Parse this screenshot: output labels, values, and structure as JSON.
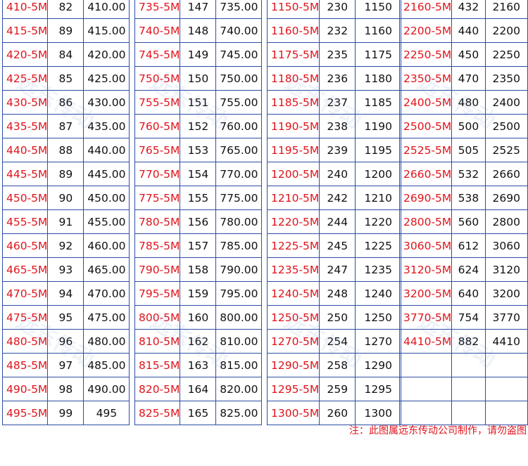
{
  "tables": [
    {
      "rows": [
        [
          "410-5M",
          "82",
          "410.00"
        ],
        [
          "415-5M",
          "89",
          "415.00"
        ],
        [
          "420-5M",
          "84",
          "420.00"
        ],
        [
          "425-5M",
          "85",
          "425.00"
        ],
        [
          "430-5M",
          "86",
          "430.00"
        ],
        [
          "435-5M",
          "87",
          "435.00"
        ],
        [
          "440-5M",
          "88",
          "440.00"
        ],
        [
          "445-5M",
          "89",
          "445.00"
        ],
        [
          "450-5M",
          "90",
          "450.00"
        ],
        [
          "455-5M",
          "91",
          "455.00"
        ],
        [
          "460-5M",
          "92",
          "460.00"
        ],
        [
          "465-5M",
          "93",
          "465.00"
        ],
        [
          "470-5M",
          "94",
          "470.00"
        ],
        [
          "475-5M",
          "95",
          "475.00"
        ],
        [
          "480-5M",
          "96",
          "480.00"
        ],
        [
          "485-5M",
          "97",
          "485.00"
        ],
        [
          "490-5M",
          "98",
          "490.00"
        ],
        [
          "495-5M",
          "99",
          "495"
        ]
      ]
    },
    {
      "rows": [
        [
          "735-5M",
          "147",
          "735.00"
        ],
        [
          "740-5M",
          "148",
          "740.00"
        ],
        [
          "745-5M",
          "149",
          "745.00"
        ],
        [
          "750-5M",
          "150",
          "750.00"
        ],
        [
          "755-5M",
          "151",
          "755.00"
        ],
        [
          "760-5M",
          "152",
          "760.00"
        ],
        [
          "765-5M",
          "153",
          "765.00"
        ],
        [
          "770-5M",
          "154",
          "770.00"
        ],
        [
          "775-5M",
          "155",
          "775.00"
        ],
        [
          "780-5M",
          "156",
          "780.00"
        ],
        [
          "785-5M",
          "157",
          "785.00"
        ],
        [
          "790-5M",
          "158",
          "790.00"
        ],
        [
          "795-5M",
          "159",
          "795.00"
        ],
        [
          "800-5M",
          "160",
          "800.00"
        ],
        [
          "810-5M",
          "162",
          "810.00"
        ],
        [
          "815-5M",
          "163",
          "815.00"
        ],
        [
          "820-5M",
          "164",
          "820.00"
        ],
        [
          "825-5M",
          "165",
          "825.00"
        ]
      ]
    },
    {
      "rows": [
        [
          "1150-5M",
          "230",
          "1150"
        ],
        [
          "1160-5M",
          "232",
          "1160"
        ],
        [
          "1175-5M",
          "235",
          "1175"
        ],
        [
          "1180-5M",
          "236",
          "1180"
        ],
        [
          "1185-5M",
          "237",
          "1185"
        ],
        [
          "1190-5M",
          "238",
          "1190"
        ],
        [
          "1195-5M",
          "239",
          "1195"
        ],
        [
          "1200-5M",
          "240",
          "1200"
        ],
        [
          "1210-5M",
          "242",
          "1210"
        ],
        [
          "1220-5M",
          "244",
          "1220"
        ],
        [
          "1225-5M",
          "245",
          "1225"
        ],
        [
          "1235-5M",
          "247",
          "1235"
        ],
        [
          "1240-5M",
          "248",
          "1240"
        ],
        [
          "1250-5M",
          "250",
          "1250"
        ],
        [
          "1270-5M",
          "254",
          "1270"
        ],
        [
          "1290-5M",
          "258",
          "1290"
        ],
        [
          "1295-5M",
          "259",
          "1295"
        ],
        [
          "1300-5M",
          "260",
          "1300"
        ]
      ]
    },
    {
      "rows": [
        [
          "2160-5M",
          "432",
          "2160"
        ],
        [
          "2200-5M",
          "440",
          "2200"
        ],
        [
          "2250-5M",
          "450",
          "2250"
        ],
        [
          "2350-5M",
          "470",
          "2350"
        ],
        [
          "2400-5M",
          "480",
          "2400"
        ],
        [
          "2500-5M",
          "500",
          "2500"
        ],
        [
          "2525-5M",
          "505",
          "2525"
        ],
        [
          "2660-5M",
          "532",
          "2660"
        ],
        [
          "2690-5M",
          "538",
          "2690"
        ],
        [
          "2800-5M",
          "560",
          "2800"
        ],
        [
          "3060-5M",
          "612",
          "3060"
        ],
        [
          "3120-5M",
          "624",
          "3120"
        ],
        [
          "3200-5M",
          "640",
          "3200"
        ],
        [
          "3770-5M",
          "754",
          "3770"
        ],
        [
          "4410-5M",
          "882",
          "4410"
        ],
        [
          "",
          "",
          ""
        ],
        [
          "",
          "",
          ""
        ],
        [
          "",
          "",
          ""
        ]
      ]
    }
  ],
  "watermark": "远东传动",
  "footer_note": "注：此图属远东传动公司制作，请勿盗图"
}
